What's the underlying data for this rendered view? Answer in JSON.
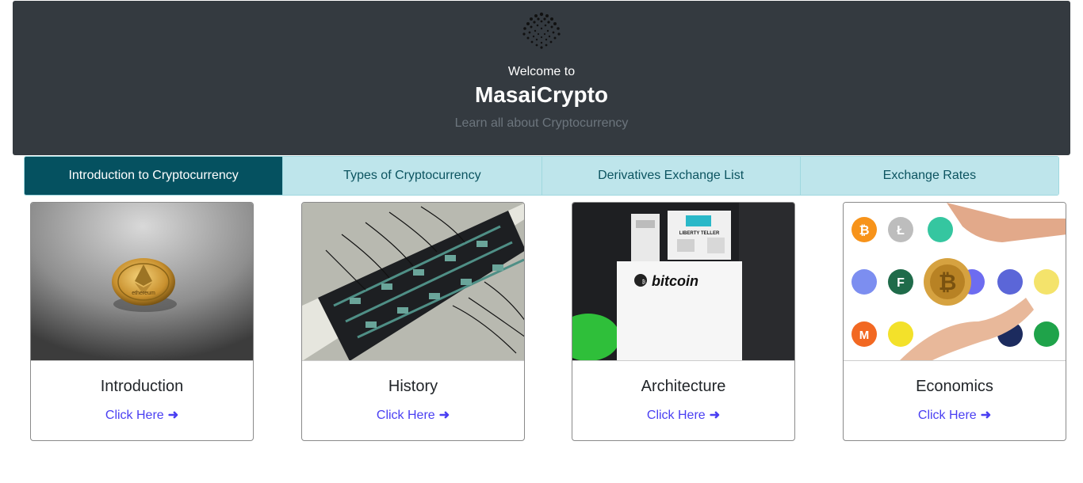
{
  "header": {
    "logo_icon": "iota-logo-icon",
    "welcome": "Welcome to",
    "title": "MasaiCrypto",
    "tagline": "Learn all about Cryptocurrency"
  },
  "tabs": [
    {
      "label": "Introduction to Cryptocurrency",
      "active": true
    },
    {
      "label": "Types of Cryptocurrency",
      "active": false
    },
    {
      "label": "Derivatives Exchange List",
      "active": false
    },
    {
      "label": "Exchange Rates",
      "active": false
    }
  ],
  "cards": [
    {
      "title": "Introduction",
      "link": "Click Here",
      "image": "ethereum-coin",
      "coin_text": "ethereum"
    },
    {
      "title": "History",
      "link": "Click Here",
      "image": "mining-rig"
    },
    {
      "title": "Architecture",
      "link": "Click Here",
      "image": "bitcoin-atm",
      "atm_text": "bitcoin",
      "atm_brand": "LIBERTY TELLER"
    },
    {
      "title": "Economics",
      "link": "Click Here",
      "image": "crypto-coins-hand"
    }
  ],
  "colors": {
    "hero_bg": "#343a40",
    "tab_bg": "#bee5eb",
    "tab_active_bg": "#055160",
    "link": "#4a3ff2"
  }
}
